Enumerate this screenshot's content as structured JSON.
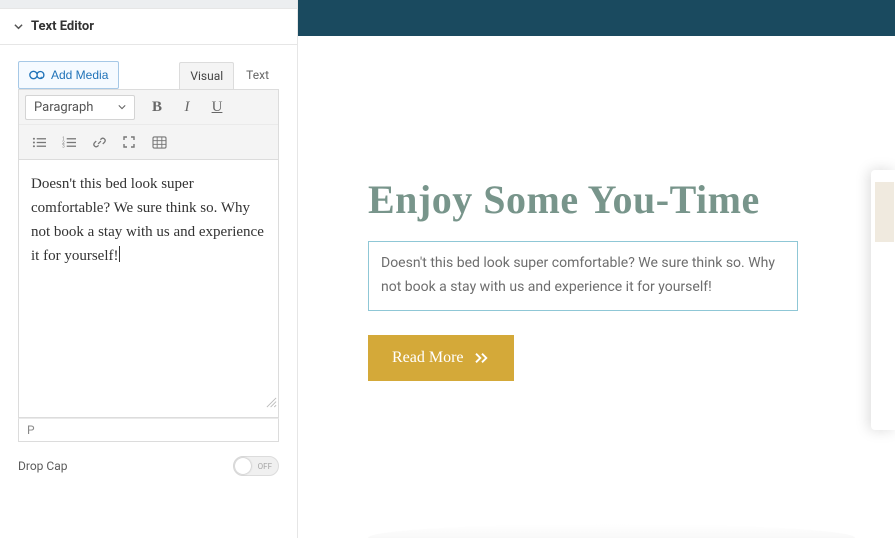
{
  "sidebar": {
    "widget_title": "Text Editor",
    "add_media_label": "Add Media",
    "tabs": {
      "visual": "Visual",
      "text": "Text"
    },
    "format_select": "Paragraph",
    "editor_content": "Doesn't this bed look super comfortable? We sure think so. Why not book a stay with us and experience it for yourself!",
    "status_path": "P",
    "drop_cap_label": "Drop Cap",
    "drop_cap_value": "OFF"
  },
  "preview": {
    "heading": "Enjoy Some You-Time",
    "body_text": "Doesn't this bed look super comfortable? We sure think so. Why not book a stay with us and experience it for yourself!",
    "read_more_label": "Read More"
  },
  "colors": {
    "preview_header": "#1a4a5f",
    "heading_color": "#78958b",
    "selection_border": "#8fc7d6",
    "cta_bg": "#d4a939"
  }
}
